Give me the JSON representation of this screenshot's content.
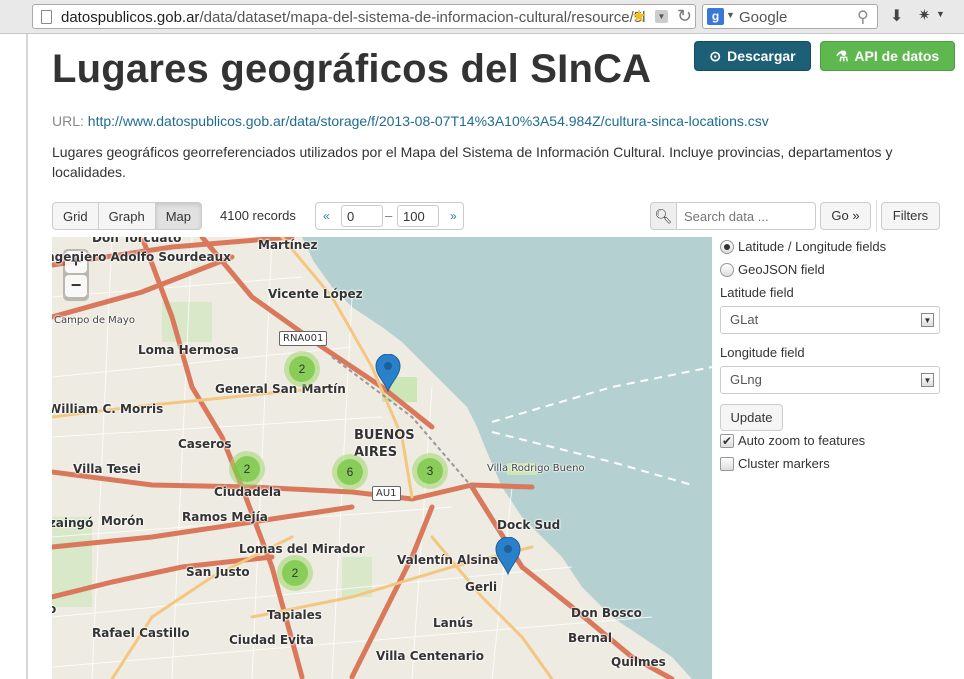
{
  "browser": {
    "url_domain": "datospublicos.gob.ar",
    "url_path": "/data/dataset/mapa-del-sistema-de-informacion-cultural/resource/5l",
    "search_engine": "Google",
    "search_placeholder": "Google"
  },
  "page": {
    "title": "Lugares geográficos del SInCA",
    "download_label": "Descargar",
    "api_label": "API de datos",
    "url_prefix": "URL:",
    "resource_url": "http://www.datospublicos.gob.ar/data/storage/f/2013-08-07T14%3A10%3A54.984Z/cultura-sinca-locations.csv",
    "description": "Lugares geográficos georreferenciados utilizados por el Mapa del Sistema de Información Cultural. Incluye provincias, departamentos y localidades."
  },
  "toolbar": {
    "views": [
      {
        "label": "Grid",
        "active": false
      },
      {
        "label": "Graph",
        "active": false
      },
      {
        "label": "Map",
        "active": true
      }
    ],
    "records": "4100 records",
    "pager_prev": "«",
    "pager_from": "0",
    "pager_dash": "–",
    "pager_to": "100",
    "pager_next": "»",
    "search_placeholder": "Search data ...",
    "go_label": "Go »",
    "filters_label": "Filters"
  },
  "map": {
    "zoom_in": "+",
    "zoom_out": "−",
    "labels": {
      "don_torcuato": "Don Torcuato",
      "martinez": "Martínez",
      "adolfo_sourdeaux": "ingeniero Adolfo Sourdeaux",
      "vicente_lopez": "Vicente López",
      "campo_de_mayo": "Campo de Mayo",
      "rna001": "RNA001",
      "loma_hermosa": "Loma Hermosa",
      "general_san_martin": "General San Martín",
      "william_morris": "William C. Morris",
      "buenos_aires": "BUENOS\nAIRES",
      "caseros": "Caseros",
      "villa_tesei": "Villa Tesei",
      "villa_rodrigo_bueno": "Villa Rodrigo Bueno",
      "ciudadela": "Ciudadela",
      "au1": "AU1",
      "ituzaingo": "Ituzaingó",
      "moron": "Morón",
      "ramos_mejia": "Ramos Mejía",
      "dock_sud": "Dock Sud",
      "lomas_del_mirador": "Lomas del Mirador",
      "valentin_alsina": "Valentín Alsina",
      "san_justo": "San Justo",
      "gerli": "Gerli",
      "tapiales": "Tapiales",
      "don_bosco": "Don Bosco",
      "rafael_castillo": "Rafael Castillo",
      "lanus": "Lanús",
      "ciudad_evita": "Ciudad Evita",
      "bernal": "Bernal",
      "villa_centenario": "Villa Centenario",
      "quilmes": "Quilmes",
      "edge_o": "o"
    },
    "clusters": [
      "2",
      "2",
      "6",
      "3",
      "2"
    ]
  },
  "panel": {
    "option_latlng": "Latitude / Longitude fields",
    "option_geojson": "GeoJSON field",
    "lat_label": "Latitude field",
    "lat_value": "GLat",
    "lng_label": "Longitude field",
    "lng_value": "GLng",
    "update_label": "Update",
    "auto_zoom_label": "Auto zoom to features",
    "auto_zoom_checked": true,
    "cluster_label": "Cluster markers",
    "cluster_checked": false
  },
  "colors": {
    "download_btn": "#1d5f76",
    "api_btn": "#5fb84f",
    "link": "#1f6c91",
    "water": "#b5d0d0",
    "marker": "#2a81cb"
  }
}
